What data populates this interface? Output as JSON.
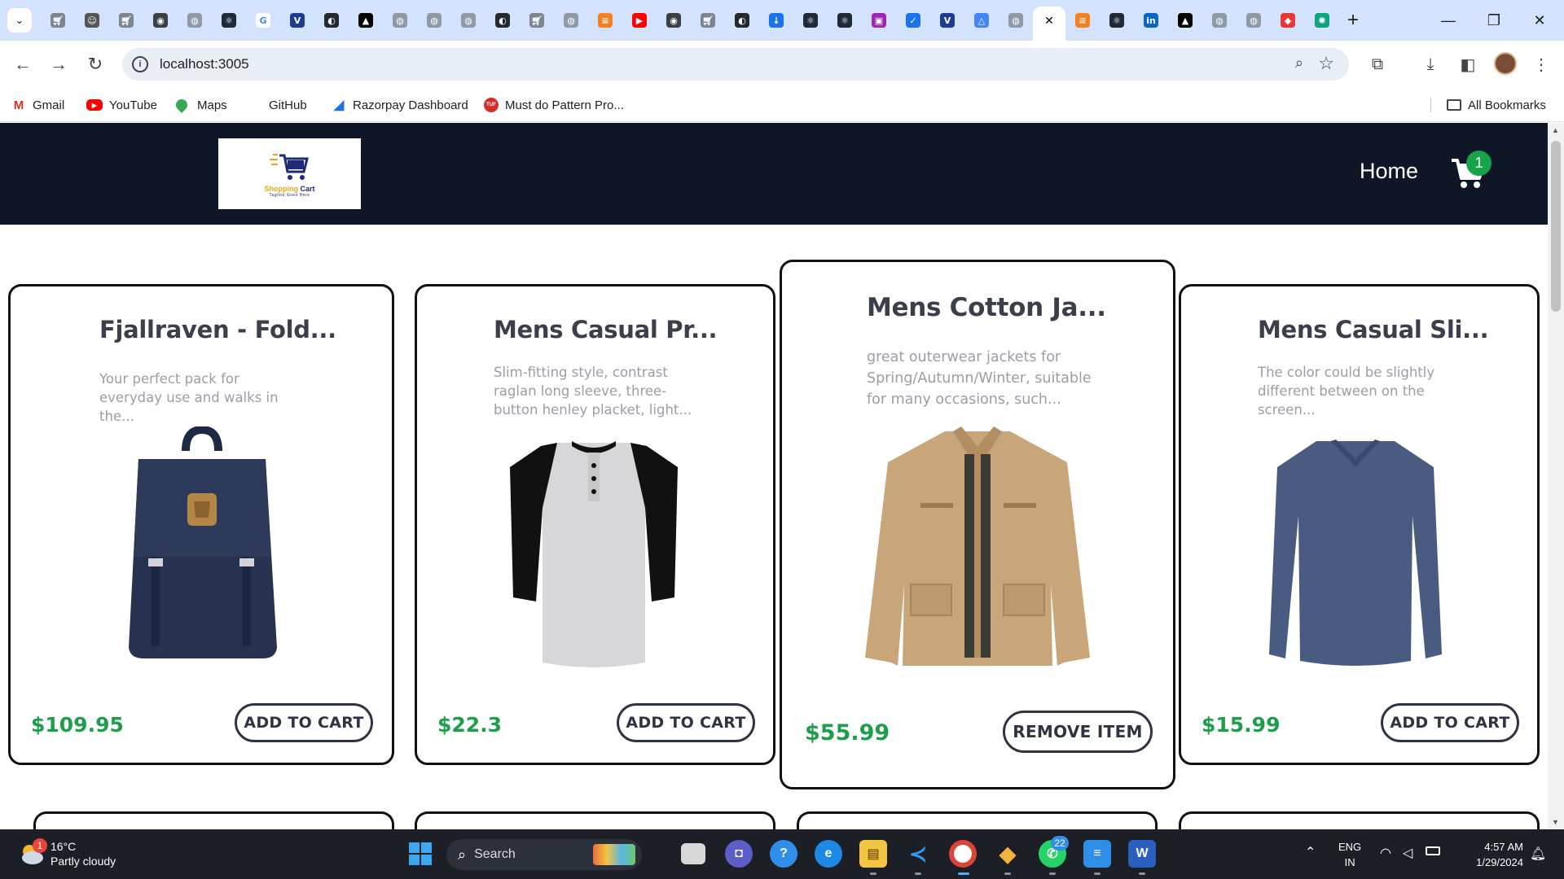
{
  "browser": {
    "tab_icons": [
      "cart-icon",
      "robot-icon",
      "cart-icon",
      "chrome-icon",
      "globe-icon",
      "react-icon",
      "google-icon",
      "v-icon",
      "github-icon",
      "vercel-icon",
      "globe-icon",
      "globe-icon",
      "globe-icon",
      "github-icon",
      "cart-icon",
      "globe-icon",
      "stackoverflow-icon",
      "youtube-icon",
      "chrome-icon",
      "cart-icon",
      "github-icon",
      "download-icon",
      "react-icon",
      "react-icon",
      "app-icon",
      "check-icon",
      "v-icon",
      "drive-icon",
      "globe-icon",
      "active-tab",
      "stackoverflow-icon",
      "react-icon",
      "linkedin-icon",
      "vercel-icon",
      "globe-icon",
      "globe-icon",
      "gem-icon",
      "openai-icon"
    ],
    "address": "localhost:3005",
    "bookmarks": [
      {
        "label": "Gmail",
        "icon": "gmail-icon"
      },
      {
        "label": "YouTube",
        "icon": "youtube-icon"
      },
      {
        "label": "Maps",
        "icon": "maps-icon"
      },
      {
        "label": "GitHub",
        "icon": "github-icon"
      },
      {
        "label": "Razorpay Dashboard",
        "icon": "razorpay-icon"
      },
      {
        "label": "Must do Pattern Pro...",
        "icon": "tuf-icon"
      }
    ],
    "all_bookmarks": "All Bookmarks"
  },
  "site": {
    "logo_brand_left": "Shopping",
    "logo_brand_right": " Cart",
    "logo_tagline": "Tagline Goes Here",
    "nav_home": "Home",
    "cart_count": "1"
  },
  "products": [
    {
      "title": "Fjallraven - Fold...",
      "desc": "Your perfect pack for everyday use and walks in the...",
      "price": "$109.95",
      "action": "ADD TO CART",
      "image": "backpack"
    },
    {
      "title": "Mens Casual Pr...",
      "desc": "Slim-fitting style, contrast raglan long sleeve, three-button henley placket, light...",
      "price": "$22.3",
      "action": "ADD TO CART",
      "image": "raglan-shirt"
    },
    {
      "title": "Mens Cotton Ja...",
      "desc": "great outerwear jackets for Spring/Autumn/Winter, suitable for many occasions, such...",
      "price": "$55.99",
      "action": "REMOVE ITEM",
      "image": "cotton-jacket"
    },
    {
      "title": "Mens Casual Sli...",
      "desc": "The color could be slightly different between on the screen...",
      "price": "$15.99",
      "action": "ADD TO CART",
      "image": "slim-tshirt"
    }
  ],
  "taskbar": {
    "weather_temp": "16°C",
    "weather_desc": "Partly cloudy",
    "weather_alert": "1",
    "search_label": "Search",
    "whatsapp_badge": "22",
    "lang_top": "ENG",
    "lang_bottom": "IN",
    "time": "4:57 AM",
    "date": "1/29/2024"
  },
  "colors": {
    "header_bg": "#0e1628",
    "price_green": "#1e9e4a",
    "badge_green": "#16a34a",
    "tabstrip_bg": "#d3e3fd"
  }
}
